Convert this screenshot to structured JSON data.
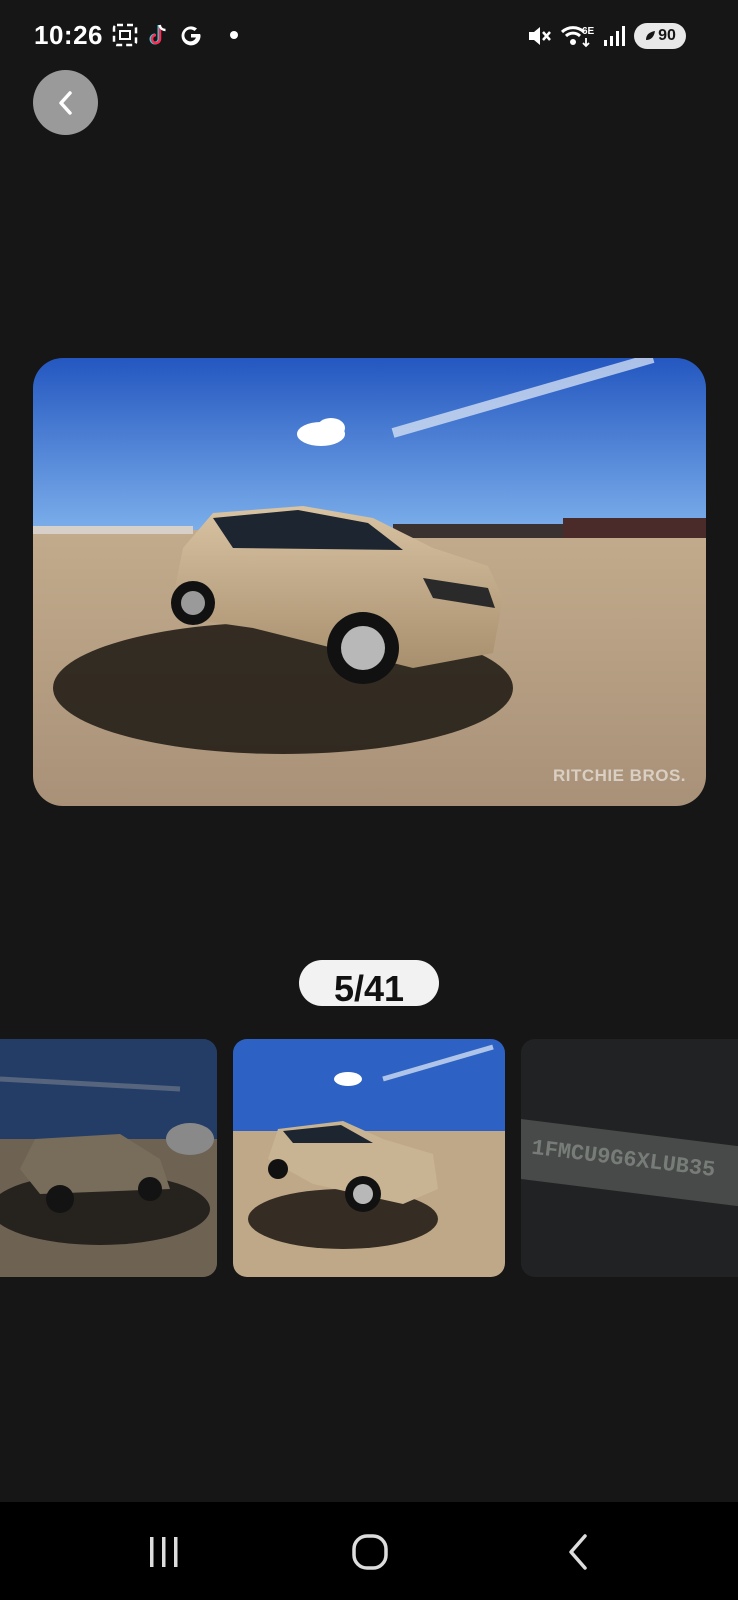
{
  "status_bar": {
    "time": "10:26",
    "battery": "90",
    "left_icons": [
      "screenshot-icon",
      "tiktok-icon",
      "google-icon",
      "notification-dot"
    ],
    "right_icons": [
      "mute-icon",
      "wifi-6e-icon",
      "signal-icon",
      "battery-icon"
    ],
    "wifi_label": "6E"
  },
  "back_button": {
    "icon": "chevron-left-icon"
  },
  "main_photo": {
    "watermark": "RITCHIE BROS."
  },
  "counter": {
    "current": "5/41"
  },
  "thumbnails": [
    {
      "name": "thumb-rear-view",
      "active": false
    },
    {
      "name": "thumb-front-view",
      "active": true
    },
    {
      "name": "thumb-vin-plate",
      "active": false,
      "text": "1FMCU9G6XLUB35"
    }
  ],
  "nav_bar": {
    "buttons": [
      "recents-button",
      "home-button",
      "back-button"
    ]
  },
  "colors": {
    "background": "#161616",
    "sky": "#2f67c9",
    "ground": "#bca68a",
    "car": "#c5ad8a"
  }
}
